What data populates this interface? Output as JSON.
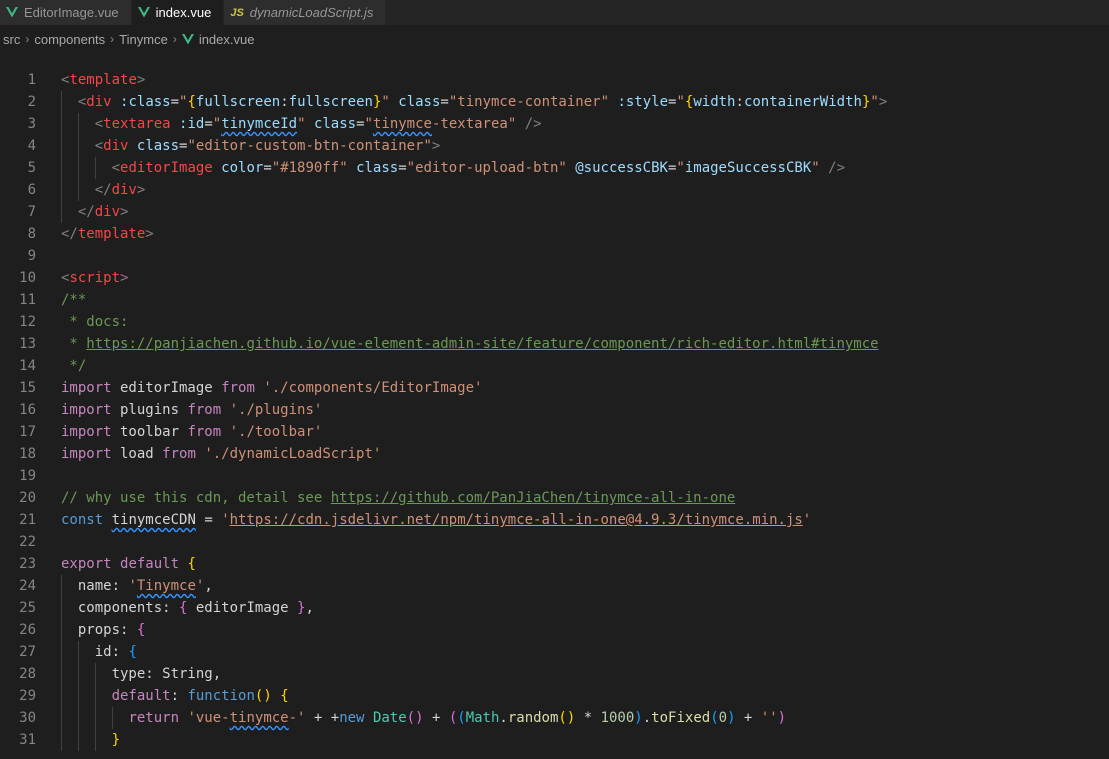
{
  "tabs": [
    {
      "label": "EditorImage.vue",
      "icon": "vue-icon",
      "active": false,
      "italic": false
    },
    {
      "label": "index.vue",
      "icon": "vue-icon",
      "active": true,
      "italic": false
    },
    {
      "label": "dynamicLoadScript.js",
      "icon": "js-icon",
      "icon_text": "JS",
      "active": false,
      "italic": true
    }
  ],
  "breadcrumb": [
    "src",
    "components",
    "Tinymce",
    "index.vue"
  ],
  "colors": {
    "background": "#1e1e1e",
    "tabbar": "#252526",
    "vue_icon": "#41b883",
    "js_icon": "#cbcb41",
    "keyword": "#c586c0",
    "string": "#ce9178",
    "attribute": "#9cdcfe",
    "tag": "#f44747",
    "comment": "#6a9955"
  },
  "code_lines": [
    {
      "n": "1",
      "indent": 0,
      "tokens": [
        [
          "t-bracket",
          "<"
        ],
        [
          "t-tag",
          "template"
        ],
        [
          "t-bracket",
          ">"
        ]
      ]
    },
    {
      "n": "2",
      "indent": 2,
      "tokens": [
        [
          "t-bracket",
          "<"
        ],
        [
          "t-tag",
          "div"
        ],
        [
          "t-text",
          " "
        ],
        [
          "t-attr",
          ":class"
        ],
        [
          "t-text",
          "="
        ],
        [
          "t-str",
          "\""
        ],
        [
          "t-brace1",
          "{"
        ],
        [
          "t-attr",
          "fullscreen"
        ],
        [
          "t-text",
          ":"
        ],
        [
          "t-attr",
          "fullscreen"
        ],
        [
          "t-brace1",
          "}"
        ],
        [
          "t-str",
          "\""
        ],
        [
          "t-text",
          " "
        ],
        [
          "t-attr",
          "class"
        ],
        [
          "t-text",
          "="
        ],
        [
          "t-str",
          "\"tinymce-container\""
        ],
        [
          "t-text",
          " "
        ],
        [
          "t-attr",
          ":style"
        ],
        [
          "t-text",
          "="
        ],
        [
          "t-str",
          "\""
        ],
        [
          "t-brace1",
          "{"
        ],
        [
          "t-attr",
          "width"
        ],
        [
          "t-text",
          ":"
        ],
        [
          "t-attr",
          "containerWidth"
        ],
        [
          "t-brace1",
          "}"
        ],
        [
          "t-str",
          "\""
        ],
        [
          "t-bracket",
          ">"
        ]
      ]
    },
    {
      "n": "3",
      "indent": 4,
      "tokens": [
        [
          "t-bracket",
          "<"
        ],
        [
          "t-tag",
          "textarea"
        ],
        [
          "t-text",
          " "
        ],
        [
          "t-attr",
          ":id"
        ],
        [
          "t-text",
          "="
        ],
        [
          "t-str",
          "\""
        ],
        [
          "t-attr squiggle",
          "tinymceId"
        ],
        [
          "t-str",
          "\""
        ],
        [
          "t-text",
          " "
        ],
        [
          "t-attr",
          "class"
        ],
        [
          "t-text",
          "="
        ],
        [
          "t-str",
          "\""
        ],
        [
          "t-str squiggle",
          "tinymce"
        ],
        [
          "t-str",
          "-textarea\""
        ],
        [
          "t-text",
          " "
        ],
        [
          "t-bracket",
          "/>"
        ]
      ]
    },
    {
      "n": "4",
      "indent": 4,
      "tokens": [
        [
          "t-bracket",
          "<"
        ],
        [
          "t-tag",
          "div"
        ],
        [
          "t-text",
          " "
        ],
        [
          "t-attr",
          "class"
        ],
        [
          "t-text",
          "="
        ],
        [
          "t-str",
          "\"editor-custom-btn-container\""
        ],
        [
          "t-bracket",
          ">"
        ]
      ]
    },
    {
      "n": "5",
      "indent": 6,
      "tokens": [
        [
          "t-bracket",
          "<"
        ],
        [
          "t-tag",
          "editorImage"
        ],
        [
          "t-text",
          " "
        ],
        [
          "t-attr",
          "color"
        ],
        [
          "t-text",
          "="
        ],
        [
          "t-str",
          "\"#1890ff\""
        ],
        [
          "t-text",
          " "
        ],
        [
          "t-attr",
          "class"
        ],
        [
          "t-text",
          "="
        ],
        [
          "t-str",
          "\"editor-upload-btn\""
        ],
        [
          "t-text",
          " "
        ],
        [
          "t-attr",
          "@successCBK"
        ],
        [
          "t-text",
          "="
        ],
        [
          "t-str",
          "\""
        ],
        [
          "t-attr",
          "imageSuccessCBK"
        ],
        [
          "t-str",
          "\""
        ],
        [
          "t-text",
          " "
        ],
        [
          "t-bracket",
          "/>"
        ]
      ]
    },
    {
      "n": "6",
      "indent": 4,
      "tokens": [
        [
          "t-bracket",
          "</"
        ],
        [
          "t-tag",
          "div"
        ],
        [
          "t-bracket",
          ">"
        ]
      ]
    },
    {
      "n": "7",
      "indent": 2,
      "tokens": [
        [
          "t-bracket",
          "</"
        ],
        [
          "t-tag",
          "div"
        ],
        [
          "t-bracket",
          ">"
        ]
      ]
    },
    {
      "n": "8",
      "indent": 0,
      "tokens": [
        [
          "t-bracket",
          "</"
        ],
        [
          "t-tag",
          "template"
        ],
        [
          "t-bracket",
          ">"
        ]
      ]
    },
    {
      "n": "9",
      "indent": 0,
      "tokens": []
    },
    {
      "n": "10",
      "indent": 0,
      "tokens": [
        [
          "t-bracket",
          "<"
        ],
        [
          "t-tag",
          "script"
        ],
        [
          "t-bracket",
          ">"
        ]
      ]
    },
    {
      "n": "11",
      "indent": 0,
      "tokens": [
        [
          "t-comment",
          "/**"
        ]
      ]
    },
    {
      "n": "12",
      "indent": 0,
      "tokens": [
        [
          "t-comment",
          " * docs:"
        ]
      ]
    },
    {
      "n": "13",
      "indent": 0,
      "tokens": [
        [
          "t-comment",
          " * "
        ],
        [
          "t-comment link",
          "https://panjiachen.github.io/vue-element-admin-site/feature/component/rich-editor.html#tinymce"
        ]
      ]
    },
    {
      "n": "14",
      "indent": 0,
      "tokens": [
        [
          "t-comment",
          " */"
        ]
      ]
    },
    {
      "n": "15",
      "indent": 0,
      "tokens": [
        [
          "t-kw",
          "import"
        ],
        [
          "t-text",
          " editorImage "
        ],
        [
          "t-kw",
          "from"
        ],
        [
          "t-text",
          " "
        ],
        [
          "t-str",
          "'./components/EditorImage'"
        ]
      ]
    },
    {
      "n": "16",
      "indent": 0,
      "tokens": [
        [
          "t-kw",
          "import"
        ],
        [
          "t-text",
          " plugins "
        ],
        [
          "t-kw",
          "from"
        ],
        [
          "t-text",
          " "
        ],
        [
          "t-str",
          "'./plugins'"
        ]
      ]
    },
    {
      "n": "17",
      "indent": 0,
      "tokens": [
        [
          "t-kw",
          "import"
        ],
        [
          "t-text",
          " toolbar "
        ],
        [
          "t-kw",
          "from"
        ],
        [
          "t-text",
          " "
        ],
        [
          "t-str",
          "'./toolbar'"
        ]
      ]
    },
    {
      "n": "18",
      "indent": 0,
      "tokens": [
        [
          "t-kw",
          "import"
        ],
        [
          "t-text",
          " load "
        ],
        [
          "t-kw",
          "from"
        ],
        [
          "t-text",
          " "
        ],
        [
          "t-str",
          "'./dynamicLoadScript'"
        ]
      ]
    },
    {
      "n": "19",
      "indent": 0,
      "tokens": []
    },
    {
      "n": "20",
      "indent": 0,
      "tokens": [
        [
          "t-comment",
          "// why use this cdn, detail see "
        ],
        [
          "t-comment link",
          "https://github.com/PanJiaChen/tinymce-all-in-one"
        ]
      ]
    },
    {
      "n": "21",
      "indent": 0,
      "tokens": [
        [
          "t-def",
          "const"
        ],
        [
          "t-text",
          " "
        ],
        [
          "t-text squiggle",
          "tinymceCDN"
        ],
        [
          "t-text",
          " = "
        ],
        [
          "t-str",
          "'"
        ],
        [
          "t-str link",
          "https://cdn.jsdelivr.net/npm/tinymce-all-in-one@4.9.3/tinymce.min.js"
        ],
        [
          "t-str",
          "'"
        ]
      ]
    },
    {
      "n": "22",
      "indent": 0,
      "tokens": []
    },
    {
      "n": "23",
      "indent": 0,
      "tokens": [
        [
          "t-kw",
          "export"
        ],
        [
          "t-text",
          " "
        ],
        [
          "t-kw",
          "default"
        ],
        [
          "t-text",
          " "
        ],
        [
          "t-brace1",
          "{"
        ]
      ]
    },
    {
      "n": "24",
      "indent": 2,
      "tokens": [
        [
          "t-text",
          "name: "
        ],
        [
          "t-str",
          "'"
        ],
        [
          "t-str squiggle",
          "Tinymce"
        ],
        [
          "t-str",
          "'"
        ],
        [
          "t-text",
          ","
        ]
      ]
    },
    {
      "n": "25",
      "indent": 2,
      "tokens": [
        [
          "t-text",
          "components: "
        ],
        [
          "t-brace2",
          "{"
        ],
        [
          "t-text",
          " editorImage "
        ],
        [
          "t-brace2",
          "}"
        ],
        [
          "t-text",
          ","
        ]
      ]
    },
    {
      "n": "26",
      "indent": 2,
      "tokens": [
        [
          "t-text",
          "props: "
        ],
        [
          "t-brace2",
          "{"
        ]
      ]
    },
    {
      "n": "27",
      "indent": 4,
      "tokens": [
        [
          "t-text",
          "id: "
        ],
        [
          "t-brace3",
          "{"
        ]
      ]
    },
    {
      "n": "28",
      "indent": 6,
      "tokens": [
        [
          "t-text",
          "type: String,"
        ]
      ]
    },
    {
      "n": "29",
      "indent": 6,
      "tokens": [
        [
          "t-kw",
          "default"
        ],
        [
          "t-text",
          ": "
        ],
        [
          "t-def",
          "function"
        ],
        [
          "t-brace1",
          "()"
        ],
        [
          "t-text",
          " "
        ],
        [
          "t-brace1",
          "{"
        ]
      ]
    },
    {
      "n": "30",
      "indent": 8,
      "tokens": [
        [
          "t-kw",
          "return"
        ],
        [
          "t-text",
          " "
        ],
        [
          "t-str",
          "'vue-"
        ],
        [
          "t-str squiggle",
          "tinymce"
        ],
        [
          "t-str",
          "-'"
        ],
        [
          "t-text",
          " + +"
        ],
        [
          "t-def",
          "new"
        ],
        [
          "t-text",
          " "
        ],
        [
          "t-cls",
          "Date"
        ],
        [
          "t-brace2",
          "()"
        ],
        [
          "t-text",
          " + "
        ],
        [
          "t-brace2",
          "("
        ],
        [
          "t-brace3",
          "("
        ],
        [
          "t-cls",
          "Math"
        ],
        [
          "t-text",
          "."
        ],
        [
          "t-fn",
          "random"
        ],
        [
          "t-brace1",
          "()"
        ],
        [
          "t-text",
          " * "
        ],
        [
          "t-num",
          "1000"
        ],
        [
          "t-brace3",
          ")"
        ],
        [
          "t-text",
          "."
        ],
        [
          "t-fn",
          "toFixed"
        ],
        [
          "t-brace3",
          "("
        ],
        [
          "t-num",
          "0"
        ],
        [
          "t-brace3",
          ")"
        ],
        [
          "t-text",
          " + "
        ],
        [
          "t-str",
          "''"
        ],
        [
          "t-brace2",
          ")"
        ]
      ]
    },
    {
      "n": "31",
      "indent": 6,
      "tokens": [
        [
          "t-brace1",
          "}"
        ]
      ]
    }
  ]
}
